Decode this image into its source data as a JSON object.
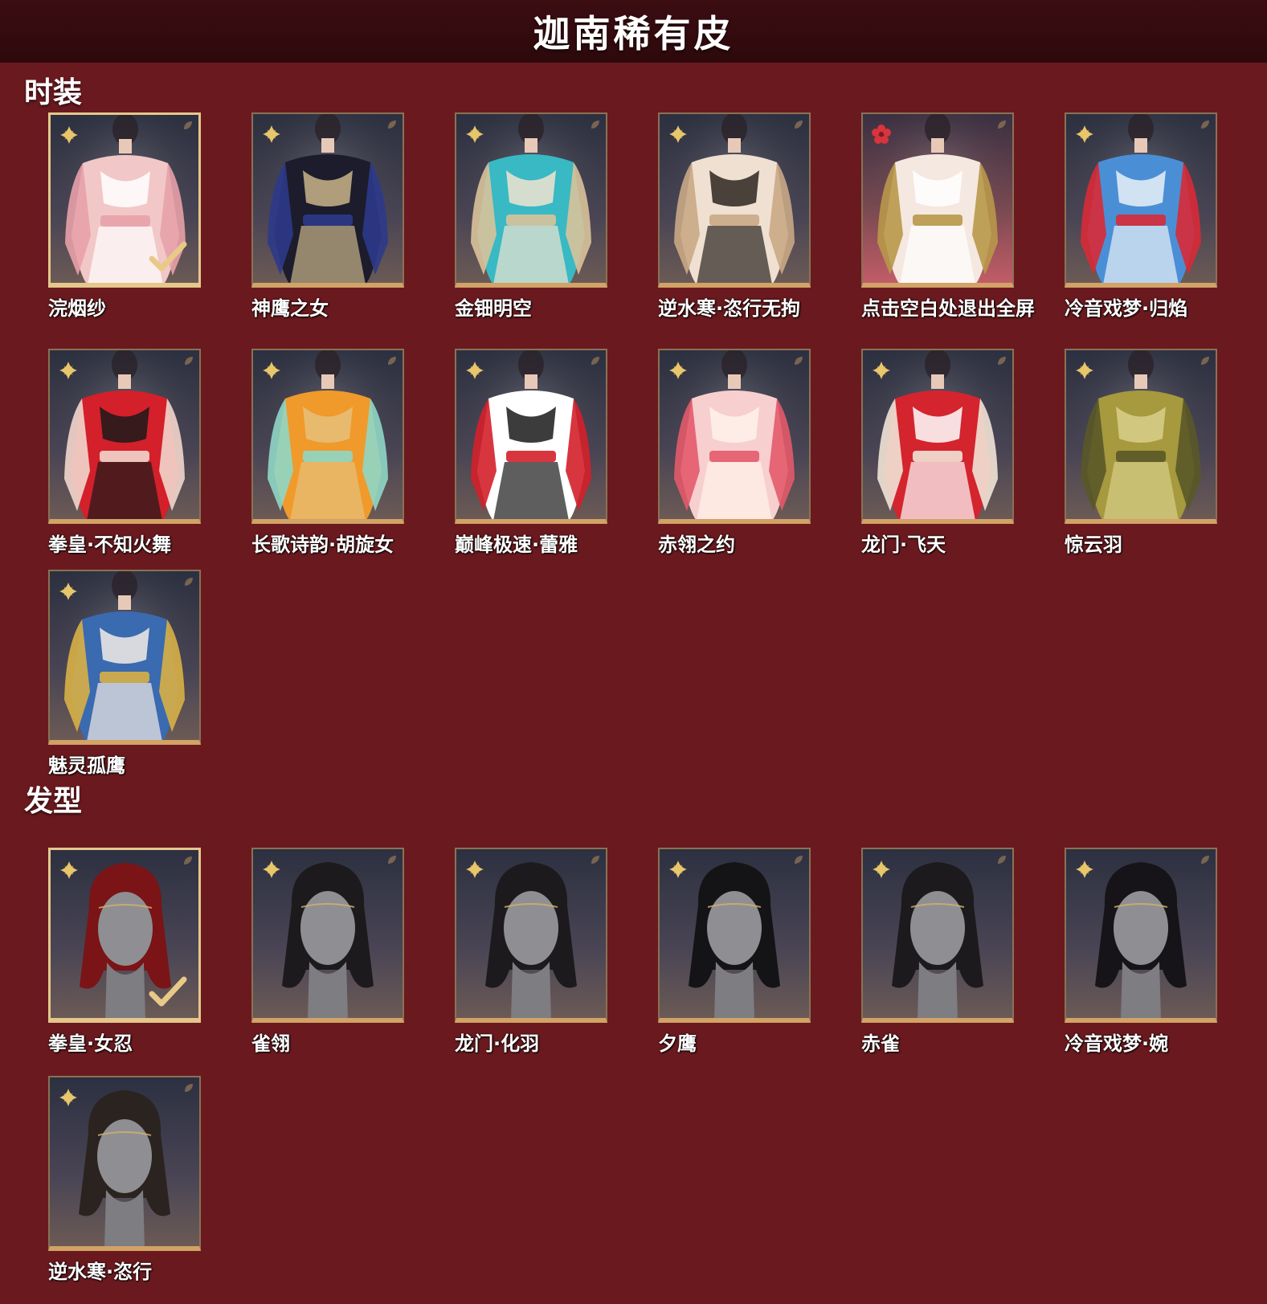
{
  "title": "迦南稀有皮",
  "colors": {
    "background": "#6a1a1f",
    "header": "#2d090c",
    "frame_gold": "#d2a266",
    "rarity_gold": "#e8c66a",
    "rarity_red": "#d9343c"
  },
  "sections": [
    {
      "title": "时装",
      "items": [
        {
          "name": "浣烟纱",
          "selected": true,
          "rarity": "gold",
          "palette": [
            "#f2c7c7",
            "#e8a1a8",
            "#ffffff"
          ]
        },
        {
          "name": "神鹰之女",
          "selected": false,
          "rarity": "gold",
          "palette": [
            "#1c1c2c",
            "#2d3a8a",
            "#c9b48a"
          ]
        },
        {
          "name": "金钿明空",
          "selected": false,
          "rarity": "gold",
          "palette": [
            "#38b9c4",
            "#d9c39a",
            "#f1e4d0"
          ]
        },
        {
          "name": "逆水寒·恣行无拘",
          "selected": false,
          "rarity": "gold",
          "palette": [
            "#efe0d2",
            "#c9a985",
            "#2b2520"
          ]
        },
        {
          "name": "点击空白处退出全屏",
          "selected": false,
          "rarity": "red",
          "palette": [
            "#f4e8e0",
            "#b8984a",
            "#ffffff"
          ]
        },
        {
          "name": "冷音戏梦·归焰",
          "selected": false,
          "rarity": "gold",
          "palette": [
            "#4a8fd6",
            "#d82a36",
            "#e9f1f8"
          ]
        },
        {
          "name": "拳皇·不知火舞",
          "selected": false,
          "rarity": "gold",
          "palette": [
            "#d3202a",
            "#f2d6cc",
            "#1a1a1a"
          ]
        },
        {
          "name": "长歌诗韵·胡旋女",
          "selected": false,
          "rarity": "gold",
          "palette": [
            "#f09a2c",
            "#8fd7c6",
            "#e6c07a"
          ]
        },
        {
          "name": "巅峰极速·蕾雅",
          "selected": false,
          "rarity": "gold",
          "palette": [
            "#ffffff",
            "#d4202a",
            "#1a1a1a"
          ]
        },
        {
          "name": "赤翎之约",
          "selected": false,
          "rarity": "gold",
          "palette": [
            "#f7cfcf",
            "#e35a6a",
            "#fff2ea"
          ]
        },
        {
          "name": "龙门·飞天",
          "selected": false,
          "rarity": "gold",
          "palette": [
            "#d4242e",
            "#f1e3d6",
            "#ffffff"
          ]
        },
        {
          "name": "惊云羽",
          "selected": false,
          "rarity": "gold",
          "palette": [
            "#a6993e",
            "#5a5828",
            "#d8cf8a"
          ]
        },
        {
          "name": "魅灵孤鹰",
          "selected": false,
          "rarity": "gold",
          "palette": [
            "#3a6ab0",
            "#d8b046",
            "#f3ece6"
          ]
        }
      ]
    },
    {
      "title": "发型",
      "items": [
        {
          "name": "拳皇·女忍",
          "selected": true,
          "rarity": "gold",
          "hair": "#7a1416"
        },
        {
          "name": "雀翎",
          "selected": false,
          "rarity": "gold",
          "hair": "#1c1a1c"
        },
        {
          "name": "龙门·化羽",
          "selected": false,
          "rarity": "gold",
          "hair": "#1c1a1c"
        },
        {
          "name": "夕鹰",
          "selected": false,
          "rarity": "gold",
          "hair": "#141316"
        },
        {
          "name": "赤雀",
          "selected": false,
          "rarity": "gold",
          "hair": "#1c1a1c"
        },
        {
          "name": "冷音戏梦·婉",
          "selected": false,
          "rarity": "gold",
          "hair": "#161418"
        },
        {
          "name": "逆水寒·恣行",
          "selected": false,
          "rarity": "gold",
          "hair": "#2a2320"
        }
      ]
    }
  ]
}
